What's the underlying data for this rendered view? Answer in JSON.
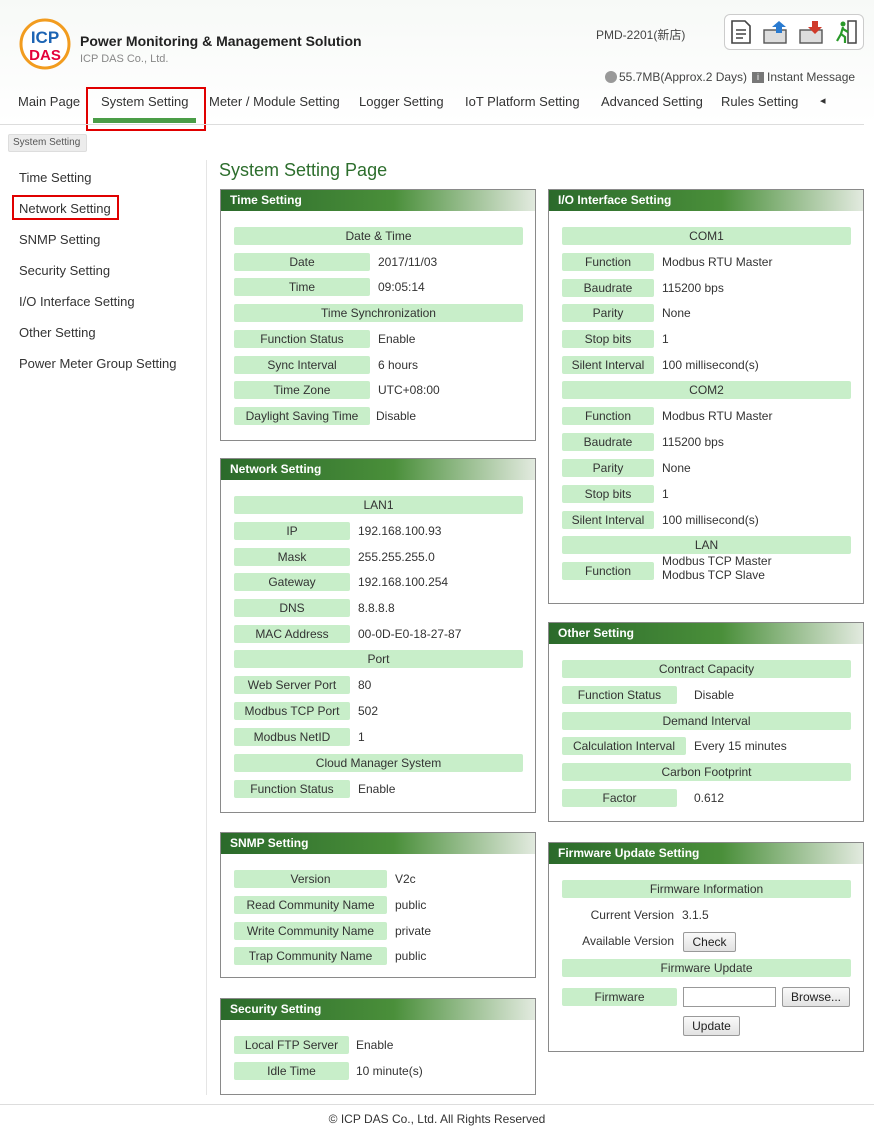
{
  "header": {
    "app_title": "Power Monitoring & Management Solution",
    "company": "ICP DAS Co., Ltd.",
    "logo_text": "ICP DAS",
    "device": "PMD-2201(新店)",
    "storage": "55.7MB(Approx.2 Days)",
    "instant_message": "Instant Message",
    "tool_icons": [
      "document-icon",
      "upload-icon",
      "download-icon",
      "logout-icon"
    ]
  },
  "nav": {
    "tabs": [
      "Main Page",
      "System Setting",
      "Meter / Module Setting",
      "Logger Setting",
      "IoT Platform Setting",
      "Advanced Setting",
      "Rules Setting"
    ],
    "active": "System Setting",
    "more": "◂"
  },
  "breadcrumb": "System Setting",
  "sidebar": {
    "items": [
      "Time Setting",
      "Network Setting",
      "SNMP Setting",
      "Security Setting",
      "I/O Interface Setting",
      "Other Setting",
      "Power Meter Group Setting"
    ],
    "highlighted": "Network Setting"
  },
  "page_title": "System Setting Page",
  "time": {
    "title": "Time Setting",
    "band1": "Date & Time",
    "date_label": "Date",
    "date_value": "2017/11/03",
    "time_label": "Time",
    "time_value": "09:05:14",
    "band2": "Time Synchronization",
    "status_label": "Function Status",
    "status_value": "Enable",
    "sync_label": "Sync Interval",
    "sync_value": "6 hours",
    "zone_label": "Time Zone",
    "zone_value": "UTC+08:00",
    "dst_label": "Daylight Saving Time",
    "dst_value": "Disable"
  },
  "network": {
    "title": "Network Setting",
    "band1": "LAN1",
    "ip_label": "IP",
    "ip_value": "192.168.100.93",
    "mask_label": "Mask",
    "mask_value": "255.255.255.0",
    "gw_label": "Gateway",
    "gw_value": "192.168.100.254",
    "dns_label": "DNS",
    "dns_value": "8.8.8.8",
    "mac_label": "MAC Address",
    "mac_value": "00-0D-E0-18-27-87",
    "band2": "Port",
    "web_label": "Web Server Port",
    "web_value": "80",
    "mtcp_label": "Modbus TCP Port",
    "mtcp_value": "502",
    "netid_label": "Modbus NetID",
    "netid_value": "1",
    "band3": "Cloud Manager System",
    "status_label": "Function Status",
    "status_value": "Enable"
  },
  "snmp": {
    "title": "SNMP Setting",
    "version_label": "Version",
    "version_value": "V2c",
    "read_label": "Read Community Name",
    "read_value": "public",
    "write_label": "Write Community Name",
    "write_value": "private",
    "trap_label": "Trap Community Name",
    "trap_value": "public"
  },
  "security": {
    "title": "Security Setting",
    "ftp_label": "Local FTP Server",
    "ftp_value": "Enable",
    "idle_label": "Idle Time",
    "idle_value": "10 minute(s)"
  },
  "io": {
    "title": "I/O Interface Setting",
    "com1": "COM1",
    "c1_func_label": "Function",
    "c1_func_value": "Modbus RTU Master",
    "c1_baud_label": "Baudrate",
    "c1_baud_value": "115200 bps",
    "c1_par_label": "Parity",
    "c1_par_value": "None",
    "c1_stop_label": "Stop bits",
    "c1_stop_value": "1",
    "c1_sil_label": "Silent Interval",
    "c1_sil_value": "100 millisecond(s)",
    "com2": "COM2",
    "c2_func_label": "Function",
    "c2_func_value": "Modbus RTU Master",
    "c2_baud_label": "Baudrate",
    "c2_baud_value": "115200 bps",
    "c2_par_label": "Parity",
    "c2_par_value": "None",
    "c2_stop_label": "Stop bits",
    "c2_stop_value": "1",
    "c2_sil_label": "Silent Interval",
    "c2_sil_value": "100 millisecond(s)",
    "lan": "LAN",
    "lan_func_label": "Function",
    "lan_func_value1": "Modbus TCP Master",
    "lan_func_value2": "Modbus TCP Slave"
  },
  "other": {
    "title": "Other Setting",
    "band1": "Contract Capacity",
    "status_label": "Function Status",
    "status_value": "Disable",
    "band2": "Demand Interval",
    "calc_label": "Calculation Interval",
    "calc_value": "Every 15 minutes",
    "band3": "Carbon Footprint",
    "factor_label": "Factor",
    "factor_value": "0.612"
  },
  "firmware": {
    "title": "Firmware Update Setting",
    "band1": "Firmware Information",
    "cur_label": "Current Version",
    "cur_value": "3.1.5",
    "avail_label": "Available Version",
    "check_button": "Check",
    "band2": "Firmware Update",
    "fw_label": "Firmware",
    "browse_button": "Browse...",
    "update_button": "Update"
  },
  "footer": "© ICP DAS Co., Ltd. All Rights Reserved"
}
